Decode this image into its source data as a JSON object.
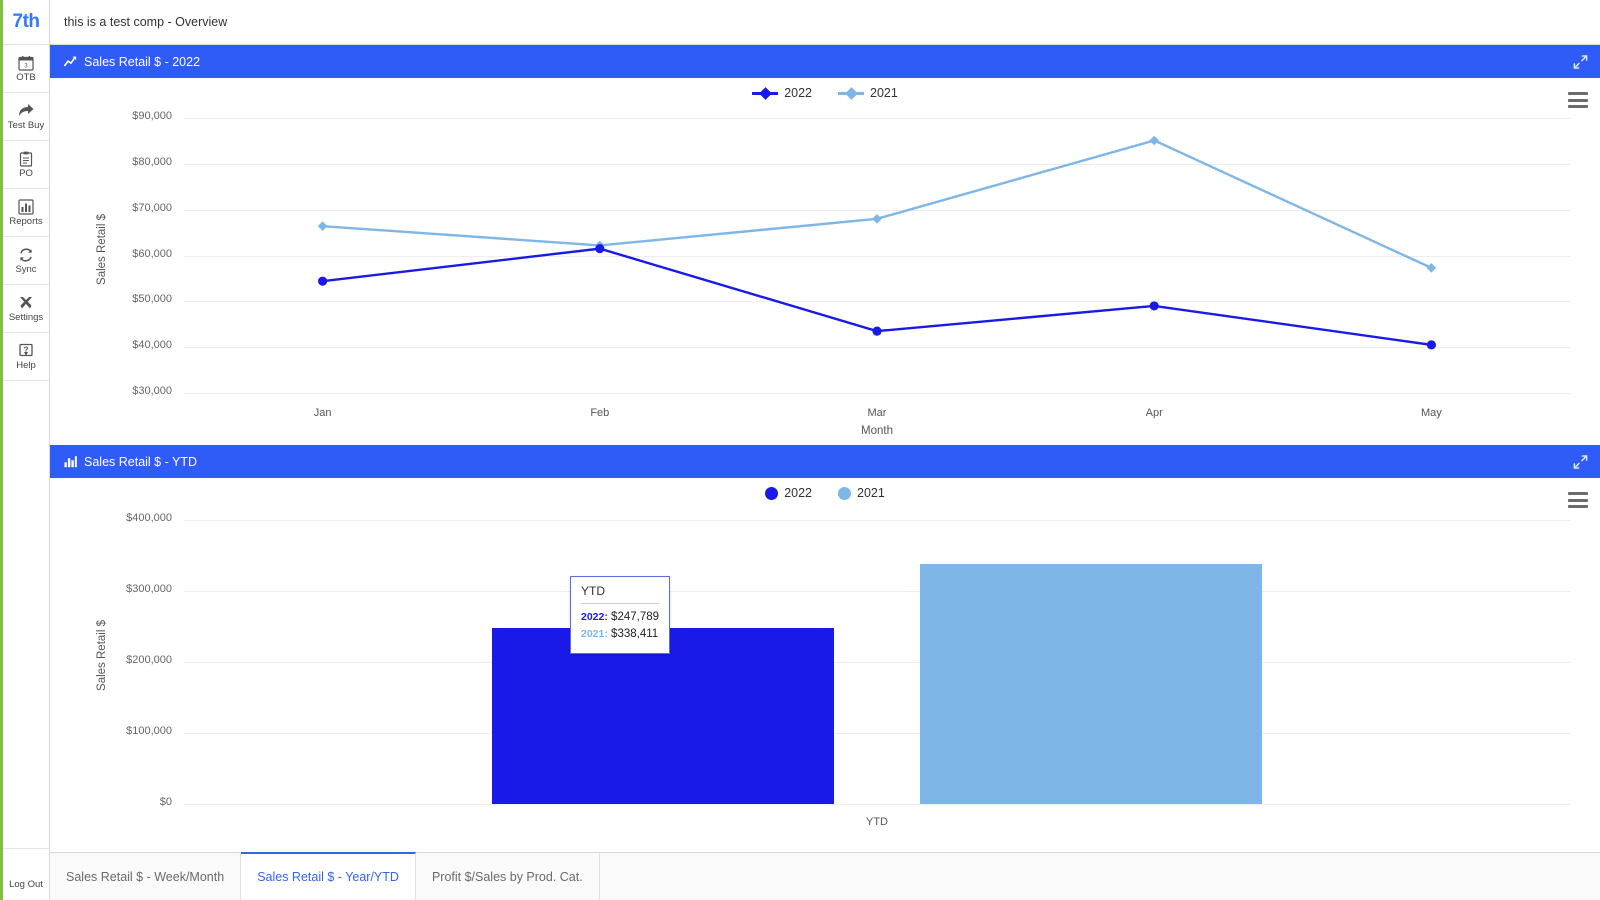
{
  "brand": {
    "logo": "7th",
    "accent": "#2f5bf6",
    "sidebar_accent": "#7ec142"
  },
  "sidebar": {
    "items": [
      {
        "label": "OTB",
        "icon": "calendar-icon"
      },
      {
        "label": "Test Buy",
        "icon": "share-arrow-icon"
      },
      {
        "label": "PO",
        "icon": "clipboard-icon"
      },
      {
        "label": "Reports",
        "icon": "bar-chart-icon"
      },
      {
        "label": "Sync",
        "icon": "sync-icon"
      },
      {
        "label": "Settings",
        "icon": "tools-icon"
      },
      {
        "label": "Help",
        "icon": "help-box-icon"
      }
    ],
    "logout": {
      "label": "Log Out",
      "icon": "power-icon"
    }
  },
  "header": {
    "title": "this is a test comp - Overview"
  },
  "panels": [
    {
      "title": "Sales Retail $ - 2022",
      "icon": "line-chart-icon",
      "expand_icon": "expand-diagonal-icon",
      "menu_icon": "hamburger-menu-icon"
    },
    {
      "title": "Sales Retail $ - YTD",
      "icon": "bar-chart-icon",
      "expand_icon": "expand-diagonal-icon",
      "menu_icon": "hamburger-menu-icon"
    }
  ],
  "tooltip": {
    "title": "YTD",
    "rows": [
      {
        "key": "2022:",
        "value": "$247,789",
        "color": "#1a1ae8"
      },
      {
        "key": "2021:",
        "value": "$338,411",
        "color": "#7fb6e8"
      }
    ]
  },
  "tabs": [
    {
      "label": "Sales Retail $ - Week/Month",
      "active": false
    },
    {
      "label": "Sales Retail $ - Year/YTD",
      "active": true
    },
    {
      "label": "Profit $/Sales by Prod. Cat.",
      "active": false
    }
  ],
  "chart_data": [
    {
      "type": "line",
      "title": "Sales Retail $ - 2022",
      "xlabel": "Month",
      "ylabel": "Sales Retail $",
      "categories": [
        "Jan",
        "Feb",
        "Mar",
        "Apr",
        "May"
      ],
      "ylim": [
        30000,
        90000
      ],
      "yticks": [
        "$30,000",
        "$40,000",
        "$50,000",
        "$60,000",
        "$70,000",
        "$80,000",
        "$90,000"
      ],
      "ytick_values": [
        30000,
        40000,
        50000,
        60000,
        70000,
        80000,
        90000
      ],
      "grid": true,
      "legend_position": "top-center",
      "series": [
        {
          "name": "2022",
          "color": "#1a1ae8",
          "marker": "circle",
          "values": [
            54400,
            61500,
            43500,
            49000,
            40500
          ]
        },
        {
          "name": "2021",
          "color": "#7fb6e8",
          "marker": "diamond",
          "values": [
            66400,
            62200,
            68000,
            85100,
            57300
          ]
        }
      ]
    },
    {
      "type": "bar",
      "title": "Sales Retail $ - YTD",
      "xlabel": "",
      "ylabel": "Sales Retail $",
      "categories": [
        "YTD"
      ],
      "ylim": [
        0,
        400000
      ],
      "yticks": [
        "$0",
        "$100,000",
        "$200,000",
        "$300,000",
        "$400,000"
      ],
      "ytick_values": [
        0,
        100000,
        200000,
        300000,
        400000
      ],
      "grid": true,
      "legend_position": "top-center",
      "series": [
        {
          "name": "2022",
          "color": "#1a1ae8",
          "values": [
            247789
          ]
        },
        {
          "name": "2021",
          "color": "#7fb6e8",
          "values": [
            338411
          ]
        }
      ]
    }
  ]
}
